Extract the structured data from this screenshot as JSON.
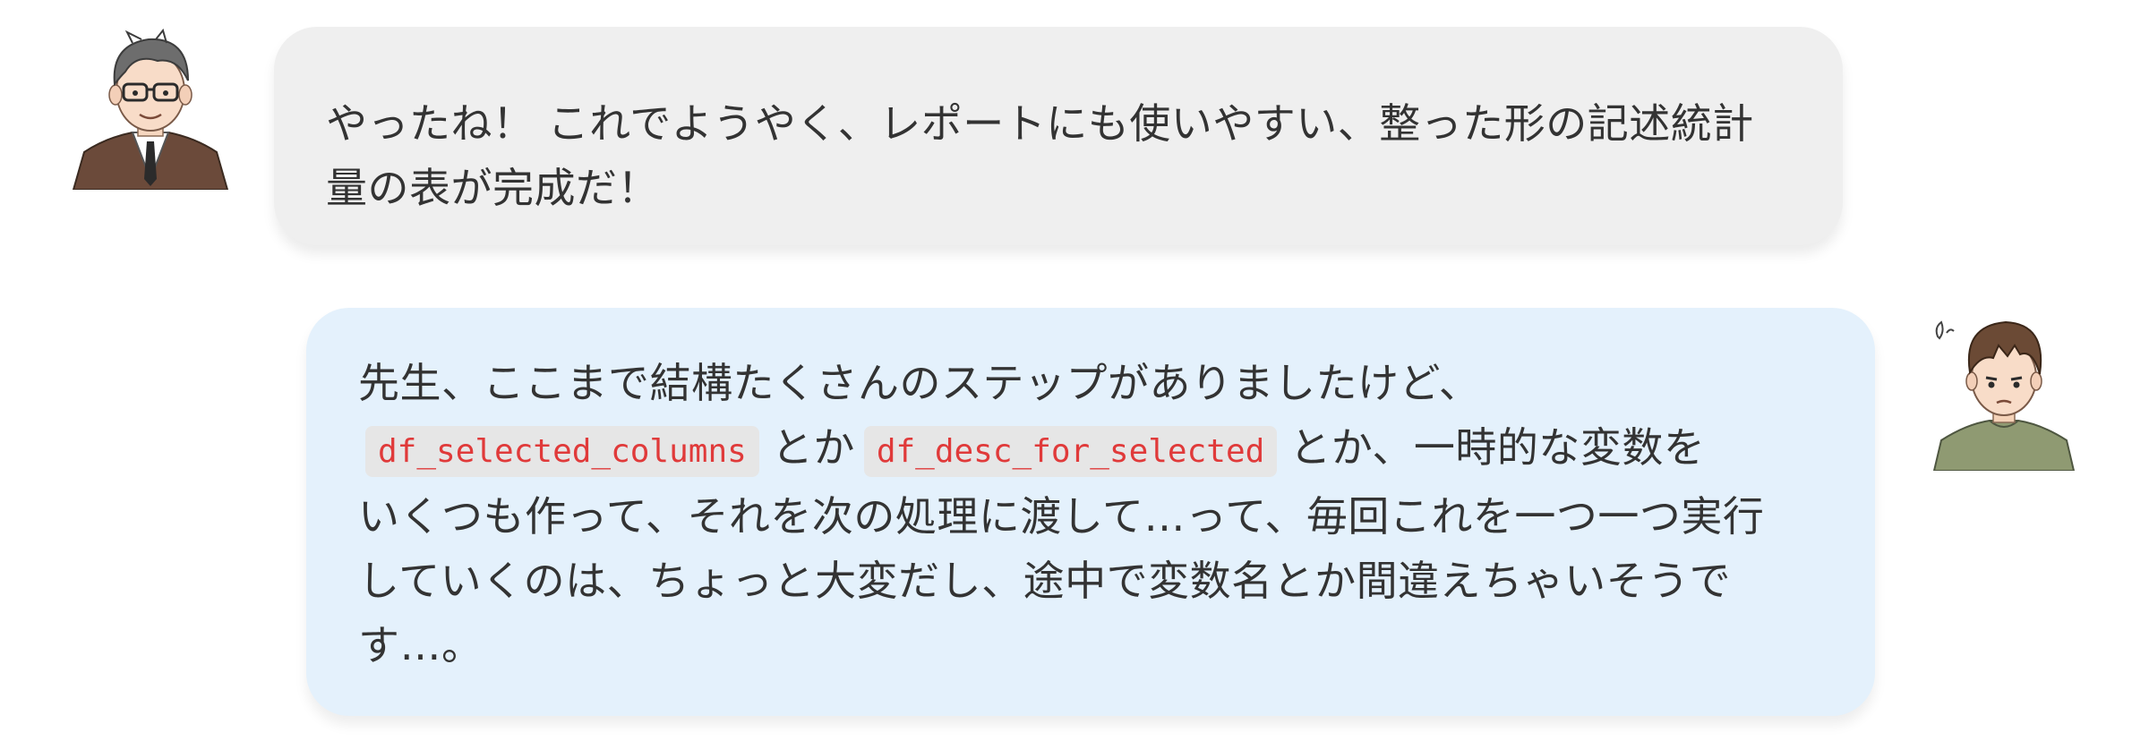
{
  "chat": {
    "messages": [
      {
        "speaker": "teacher",
        "avatar_icon": "teacher-avatar-icon",
        "lines": [
          "やったね！ これでようやく、レポートにも使いやすい、整った形の記述統計",
          "量の表が完成だ！"
        ]
      },
      {
        "speaker": "student",
        "avatar_icon": "student-avatar-icon",
        "line1": "先生、ここまで結構たくさんのステップがありましたけど、",
        "code1": "df_selected_columns",
        "between": "とか",
        "code2": "df_desc_for_selected",
        "after_code": "とか、一時的な変数を",
        "line3": "いくつも作って、それを次の処理に渡して…って、毎回これを一つ一つ実行",
        "line4": "していくのは、ちょっと大変だし、途中で変数名とか間違えちゃいそうで",
        "line5": "す…。"
      }
    ]
  },
  "colors": {
    "teacher_bubble": "#efefef",
    "student_bubble": "#e4f1fc",
    "code_text": "#e03a3a",
    "code_background": "#e6e6e6",
    "text": "#333333"
  }
}
